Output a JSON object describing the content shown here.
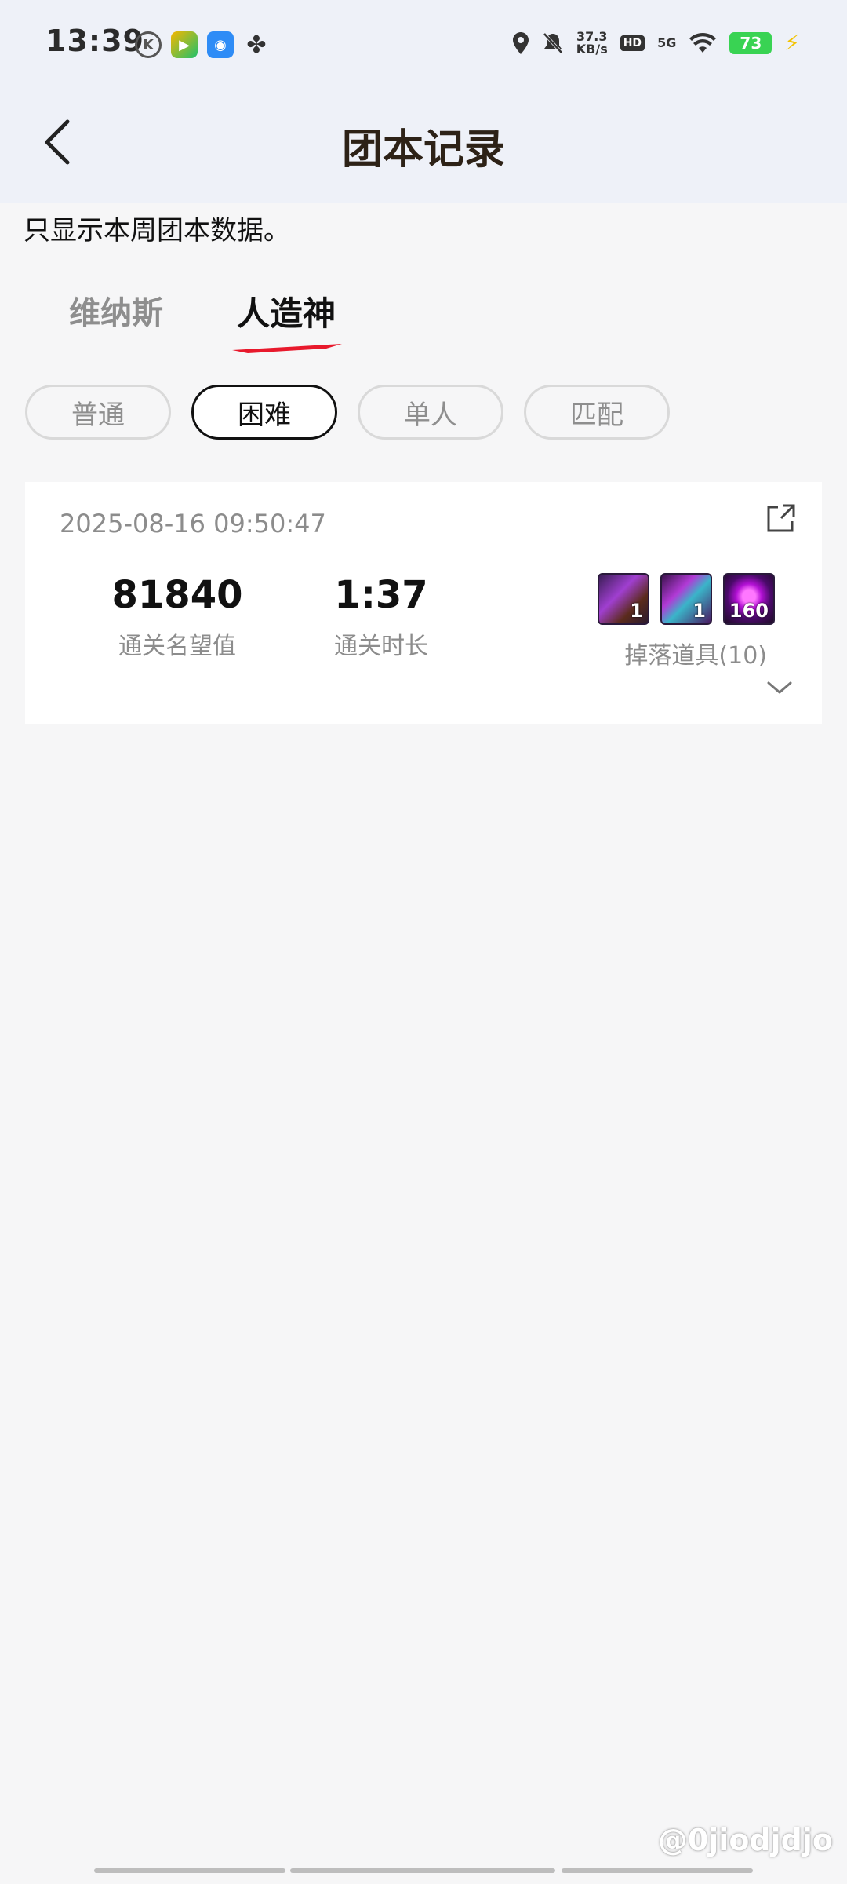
{
  "status_bar": {
    "time": "13:39",
    "speed_value": "37.3",
    "speed_unit": "KB/s",
    "hd": "HD",
    "network": "5G",
    "battery": "73",
    "app_icons": [
      "k-icon",
      "video-app-icon",
      "bag-app-icon",
      "fan-app-icon"
    ]
  },
  "header": {
    "title": "团本记录"
  },
  "notice": "只显示本周团本数据。",
  "tabs": [
    {
      "label": "维纳斯",
      "active": false
    },
    {
      "label": "人造神",
      "active": true
    }
  ],
  "filters": [
    {
      "label": "普通",
      "active": false
    },
    {
      "label": "困难",
      "active": true
    },
    {
      "label": "单人",
      "active": false
    },
    {
      "label": "匹配",
      "active": false
    }
  ],
  "record": {
    "datetime": "2025-08-16 09:50:47",
    "reputation_value": "81840",
    "reputation_label": "通关名望值",
    "duration_value": "1:37",
    "duration_label": "通关时长",
    "drops_label": "掉落道具(10)",
    "drop_items": [
      {
        "qty": "1"
      },
      {
        "qty": "1"
      },
      {
        "qty": "160"
      }
    ]
  },
  "watermark": "@0jiodjdjo",
  "colors": {
    "accent_red": "#e8192c",
    "title_brown": "#2d2217",
    "header_bg": "#eef1f8",
    "page_bg": "#f6f6f7"
  }
}
